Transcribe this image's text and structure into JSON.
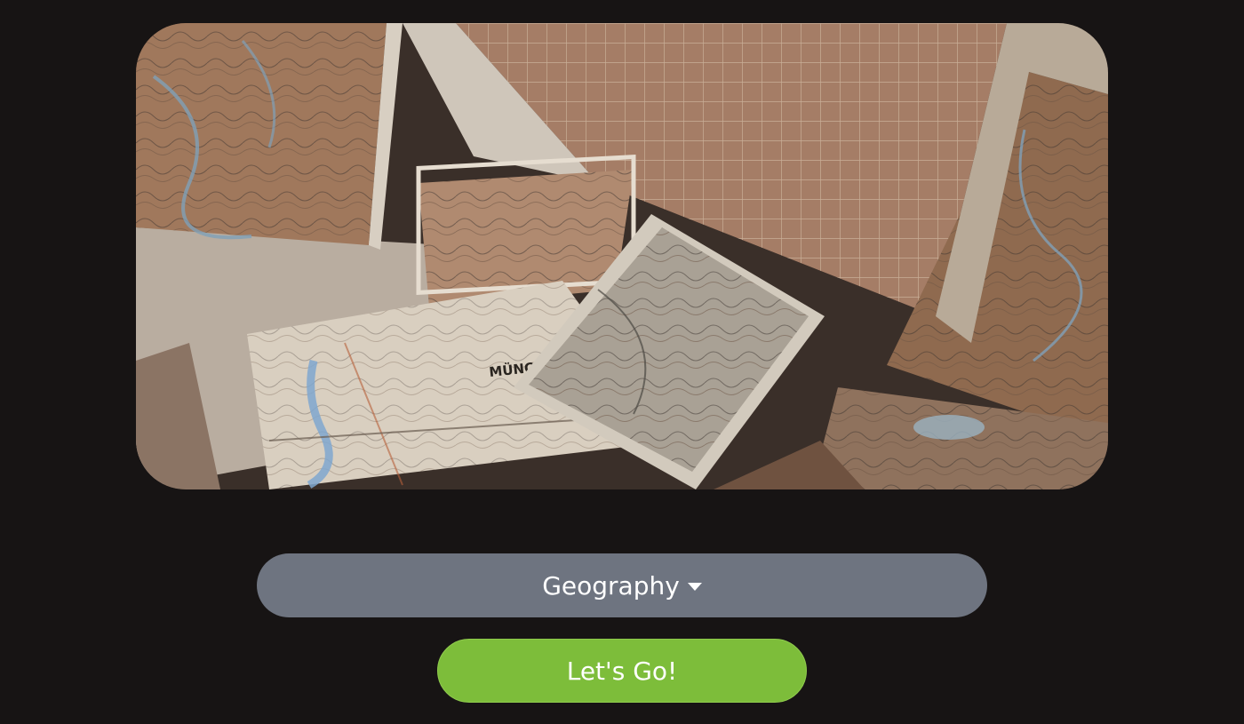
{
  "hero": {
    "image_alt": "Scattered vintage maps",
    "map_label": "MÜNC"
  },
  "category_select": {
    "selected_label": "Geography"
  },
  "start_button": {
    "label": "Let's Go!"
  },
  "colors": {
    "background": "#171414",
    "select_bg": "#6e7480",
    "button_bg": "#7dbd3a",
    "text": "#ffffff"
  }
}
